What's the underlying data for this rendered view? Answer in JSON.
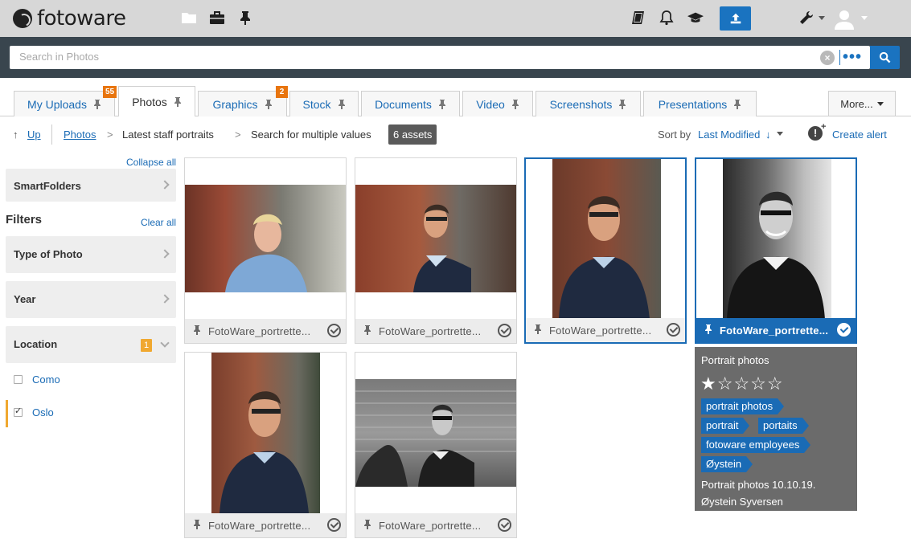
{
  "app": {
    "logo_text": "fotoware"
  },
  "topbar": {
    "icons": [
      "folder-icon",
      "briefcase-icon",
      "pin-icon",
      "book-icon",
      "bell-icon",
      "graduation-cap-icon",
      "upload-icon",
      "wrench-icon",
      "user-icon"
    ]
  },
  "search": {
    "placeholder": "Search in Photos",
    "value": "",
    "more_label": "•••"
  },
  "tabs": [
    {
      "label": "My Uploads",
      "badge": "55",
      "active": false
    },
    {
      "label": "Photos",
      "badge": "",
      "active": true
    },
    {
      "label": "Graphics",
      "badge": "2",
      "active": false
    },
    {
      "label": "Stock",
      "badge": "",
      "active": false
    },
    {
      "label": "Documents",
      "badge": "",
      "active": false
    },
    {
      "label": "Video",
      "badge": "",
      "active": false
    },
    {
      "label": "Screenshots",
      "badge": "",
      "active": false
    },
    {
      "label": "Presentations",
      "badge": "",
      "active": false
    }
  ],
  "more_tabs_label": "More...",
  "breadcrumb": {
    "up_label": "Up",
    "up_arrow": "↑",
    "items": [
      "Photos",
      "Latest staff portraits",
      "Search for multiple values"
    ],
    "separator": ">",
    "assets_count": "6 assets"
  },
  "sort": {
    "prefix": "Sort by",
    "value": "Last Modified",
    "direction": "↓"
  },
  "create_alert": {
    "label": "Create alert",
    "icon_text": "!"
  },
  "sidebar": {
    "collapse_all": "Collapse all",
    "smartfolders": "SmartFolders",
    "filters_heading": "Filters",
    "clear_all": "Clear all",
    "filters": [
      {
        "label": "Type of Photo"
      },
      {
        "label": "Year"
      },
      {
        "label": "Location",
        "badge": "1",
        "expanded": true
      }
    ],
    "location_options": [
      {
        "label": "Como",
        "checked": false
      },
      {
        "label": "Oslo",
        "checked": true
      }
    ]
  },
  "assets": [
    {
      "filename": "FotoWare_portrette...",
      "selected": false
    },
    {
      "filename": "FotoWare_portrette...",
      "selected": false
    },
    {
      "filename": "FotoWare_portrette...",
      "selected": "outline"
    },
    {
      "filename": "FotoWare_portrette...",
      "selected": "active"
    },
    {
      "filename": "FotoWare_portrette...",
      "selected": false
    },
    {
      "filename": "FotoWare_portrette...",
      "selected": false
    }
  ],
  "info_panel": {
    "title": "Portrait photos",
    "rating": 1,
    "rating_max": 5,
    "stars": "★☆☆☆☆",
    "tags": [
      "portrait photos",
      "portrait",
      "portaits",
      "fotoware employees",
      "Øystein"
    ],
    "description": "Portrait photos 10.10.19.",
    "photographer": "Øystein Syversen"
  },
  "colors": {
    "accent": "#1a73c0",
    "topbar": "#d7d7d7",
    "searchband": "#39454e",
    "badge": "#e8750f",
    "location_badge": "#f0a830",
    "info_bg": "#6b6b6b"
  }
}
